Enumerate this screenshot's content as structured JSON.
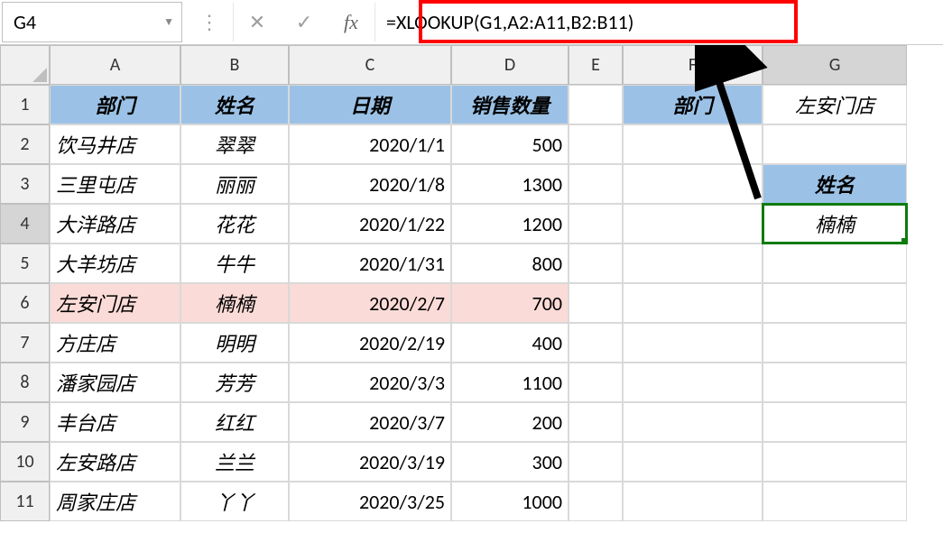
{
  "nameBox": "G4",
  "formula": "=XLOOKUP(G1,A2:A11,B2:B11)",
  "cols": [
    "A",
    "B",
    "C",
    "D",
    "E",
    "F",
    "G"
  ],
  "rows": [
    "1",
    "2",
    "3",
    "4",
    "5",
    "6",
    "7",
    "8",
    "9",
    "10",
    "11"
  ],
  "headers": {
    "A": "部门",
    "B": "姓名",
    "C": "日期",
    "D": "销售数量"
  },
  "table": [
    {
      "dept": "饮马井店",
      "name": "翠翠",
      "date": "2020/1/1",
      "qty": "500"
    },
    {
      "dept": "三里屯店",
      "name": "丽丽",
      "date": "2020/1/8",
      "qty": "1300"
    },
    {
      "dept": "大洋路店",
      "name": "花花",
      "date": "2020/1/22",
      "qty": "1200"
    },
    {
      "dept": "大羊坊店",
      "name": "牛牛",
      "date": "2020/1/31",
      "qty": "800"
    },
    {
      "dept": "左安门店",
      "name": "楠楠",
      "date": "2020/2/7",
      "qty": "700"
    },
    {
      "dept": "方庄店",
      "name": "明明",
      "date": "2020/2/19",
      "qty": "400"
    },
    {
      "dept": "潘家园店",
      "name": "芳芳",
      "date": "2020/3/3",
      "qty": "1100"
    },
    {
      "dept": "丰台店",
      "name": "红红",
      "date": "2020/3/7",
      "qty": "200"
    },
    {
      "dept": "左安路店",
      "name": "兰兰",
      "date": "2020/3/19",
      "qty": "300"
    },
    {
      "dept": "周家庄店",
      "name": "丫丫",
      "date": "2020/3/25",
      "qty": "1000"
    }
  ],
  "lookup": {
    "F1": "部门",
    "G1": "左安门店",
    "G3": "姓名",
    "G4": "楠楠"
  },
  "highlightRow": 5,
  "selectedCell": "G4",
  "icons": {
    "cancel": "✕",
    "enter": "✓",
    "dots": "⋮"
  }
}
